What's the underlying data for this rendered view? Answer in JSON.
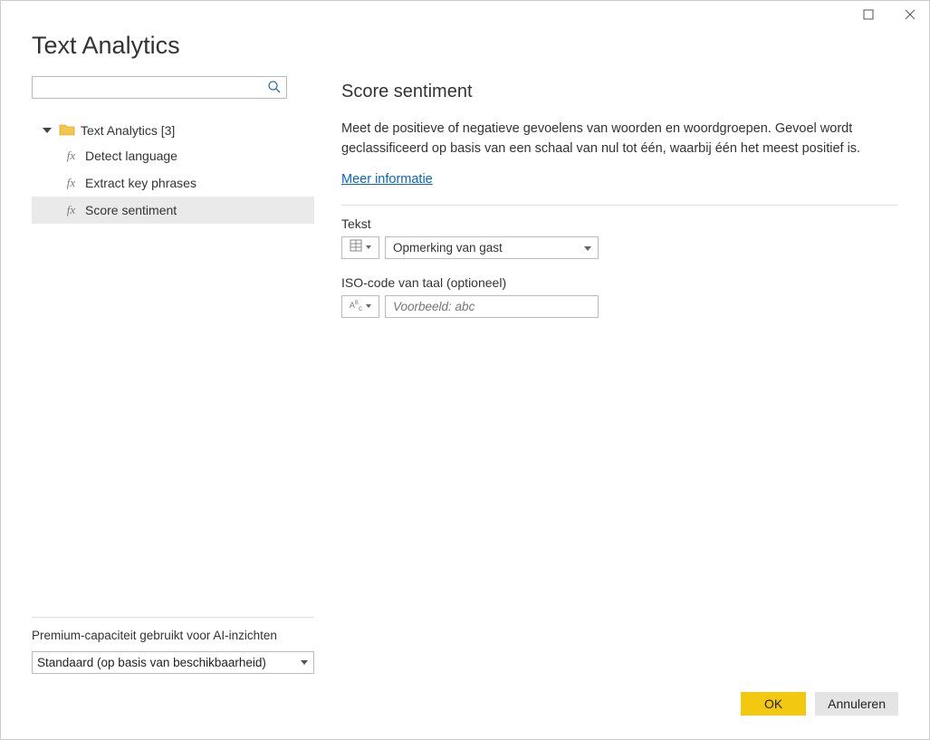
{
  "window": {
    "title": "Text Analytics"
  },
  "search": {
    "placeholder": ""
  },
  "tree": {
    "root_label": "Text Analytics [3]",
    "items": [
      {
        "label": "Detect language"
      },
      {
        "label": "Extract key phrases"
      },
      {
        "label": "Score sentiment"
      }
    ],
    "selected_index": 2
  },
  "premium": {
    "label": "Premium-capaciteit gebruikt voor AI-inzichten",
    "selected": "Standaard (op basis van beschikbaarheid)"
  },
  "detail": {
    "title": "Score sentiment",
    "description": "Meet de positieve of negatieve gevoelens van woorden en woordgroepen. Gevoel wordt geclassificeerd op basis van een schaal van nul tot één, waarbij één het meest positief is.",
    "learn_more": "Meer informatie",
    "fields": {
      "text": {
        "label": "Tekst",
        "value": "Opmerking van gast",
        "type_icon": "column"
      },
      "iso": {
        "label": "ISO-code van taal (optioneel)",
        "placeholder": "Voorbeeld: abc",
        "type_icon": "abc"
      }
    }
  },
  "buttons": {
    "ok": "OK",
    "cancel": "Annuleren"
  }
}
